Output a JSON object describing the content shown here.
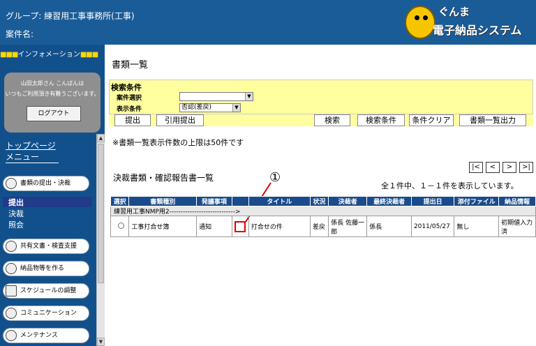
{
  "header": {
    "group": "グループ: 練習用工事事務所(工事)",
    "case_name": "案件名:",
    "logo_line1": "ぐんま",
    "logo_line2": "電子納品システム"
  },
  "sidebar": {
    "info_label": "インフォメーション",
    "user_greeting_1": "山田太郎さん こんばんは",
    "user_greeting_2": "いつもご利用頂き有難うございます。",
    "logout": "ログアウト",
    "top_page": "トップページ",
    "menu": "メニュー",
    "items": [
      {
        "label": "書類の提出・決裁",
        "icon": "document-icon"
      },
      {
        "label": "共有文書・検査支援",
        "icon": "document-icon"
      },
      {
        "label": "納品物等を作る",
        "icon": "disc-icon"
      },
      {
        "label": "スケジュールの調整",
        "icon": "calendar-icon"
      },
      {
        "label": "コミュニケーション",
        "icon": "mail-icon"
      },
      {
        "label": "メンテナンス",
        "icon": "wrench-icon"
      }
    ],
    "sub_items": [
      "提出",
      "決裁",
      "照会"
    ]
  },
  "main": {
    "title": "書類一覧",
    "search": {
      "header": "検索条件",
      "case_select_label": "案件選択",
      "case_select_value": "",
      "display_label": "表示条件",
      "display_value": "否認(差戻)"
    },
    "buttons": {
      "submit": "提出",
      "citation": "引用提出",
      "search": "検索",
      "search_cond": "検索条件",
      "clear": "条件クリア",
      "export": "書類一覧出力"
    },
    "note": "※書類一覧表示件数の上限は50件です",
    "subtitle": "決裁書類・確認報告書一覧",
    "pager": [
      "|<",
      "<",
      ">",
      ">|"
    ],
    "count_text": "全１件中、１－１件を表示しています。",
    "annotation": "①",
    "table": {
      "headers": [
        "選択",
        "書類種別",
        "発議事項",
        "",
        "タイトル",
        "状況",
        "決裁者",
        "最終決裁者",
        "提出日",
        "添付ファイル",
        "納品情報"
      ],
      "group_row": "練習用工事NMP用2----------------------------->",
      "rows": [
        {
          "type": "工事打合せ簿",
          "proposal": "通知",
          "title": "打合せの件",
          "status": "差戻",
          "approver": "係長 佐藤一郎",
          "final": "係長",
          "date": "2011/05/27",
          "attach": "無し",
          "delivery": "初期値入力済"
        }
      ]
    }
  }
}
